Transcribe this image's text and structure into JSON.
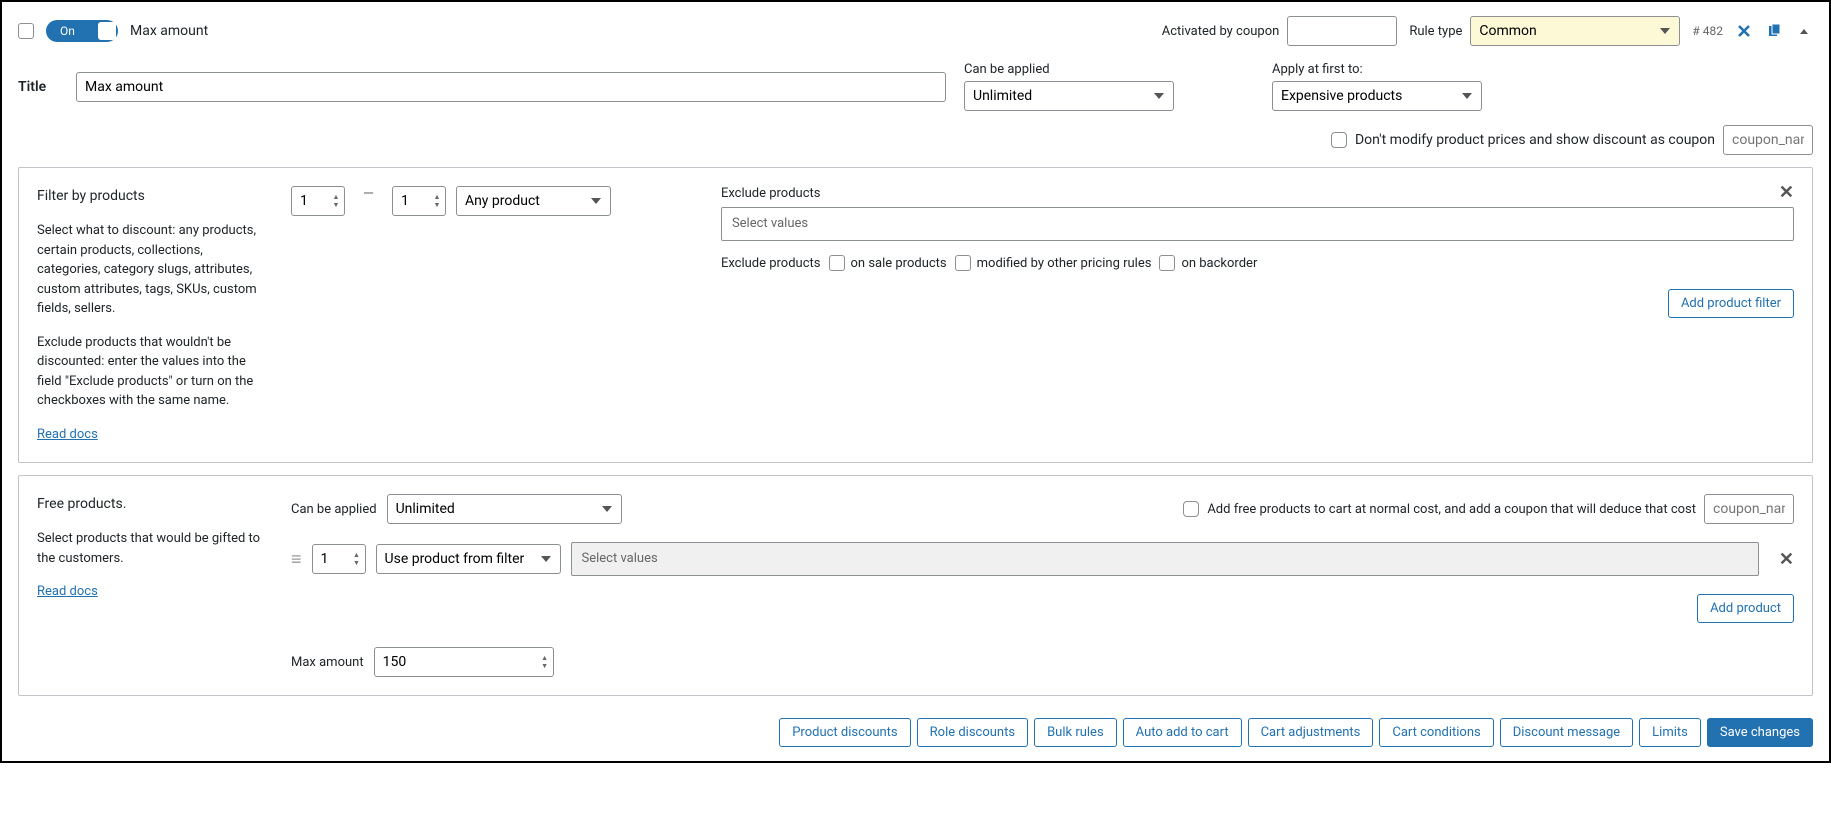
{
  "header": {
    "toggle_state": "On",
    "title_summary": "Max amount",
    "activated_by_coupon_label": "Activated by coupon",
    "activated_by_coupon_value": "",
    "rule_type_label": "Rule type",
    "rule_type_value": "Common",
    "rule_id": "# 482"
  },
  "title_row": {
    "label": "Title",
    "value": "Max amount",
    "can_be_applied_label": "Can be applied",
    "can_be_applied_value": "Unlimited",
    "apply_first_label": "Apply at first to:",
    "apply_first_value": "Expensive products"
  },
  "coupon_row": {
    "checkbox_label": "Don't modify product prices and show discount as coupon",
    "placeholder": "coupon_name"
  },
  "filter_panel": {
    "heading": "Filter by products",
    "p1": "Select what to discount: any products, certain products, collections, categories, category slugs, attributes, custom attributes, tags, SKUs, custom fields, sellers.",
    "p2": "Exclude products that wouldn't be discounted: enter the values into the field \"Exclude products\" or turn on the checkboxes with the same name.",
    "read_docs": "Read docs",
    "qty_from": "1",
    "qty_to": "1",
    "product_selector": "Any product",
    "exclude_heading": "Exclude products",
    "select_values_placeholder": "Select values",
    "exclude_label": "Exclude products",
    "cb_on_sale": "on sale products",
    "cb_modified": "modified by other pricing rules",
    "cb_backorder": "on backorder",
    "add_filter_btn": "Add product filter"
  },
  "free_panel": {
    "heading": "Free products.",
    "p1": "Select products that would be gifted to the customers.",
    "read_docs": "Read docs",
    "can_be_applied_label": "Can be applied",
    "can_be_applied_value": "Unlimited",
    "add_free_coupon_label": "Add free products to cart at normal cost, and add a coupon that will deduce that cost",
    "coupon_placeholder": "coupon_name",
    "qty": "1",
    "source_select": "Use product from filter",
    "select_values_placeholder": "Select values",
    "add_product_btn": "Add product",
    "max_amount_label": "Max amount",
    "max_amount_value": "150"
  },
  "footer": {
    "product_discounts": "Product discounts",
    "role_discounts": "Role discounts",
    "bulk_rules": "Bulk rules",
    "auto_add": "Auto add to cart",
    "cart_adjustments": "Cart adjustments",
    "cart_conditions": "Cart conditions",
    "discount_message": "Discount message",
    "limits": "Limits",
    "save": "Save changes"
  }
}
